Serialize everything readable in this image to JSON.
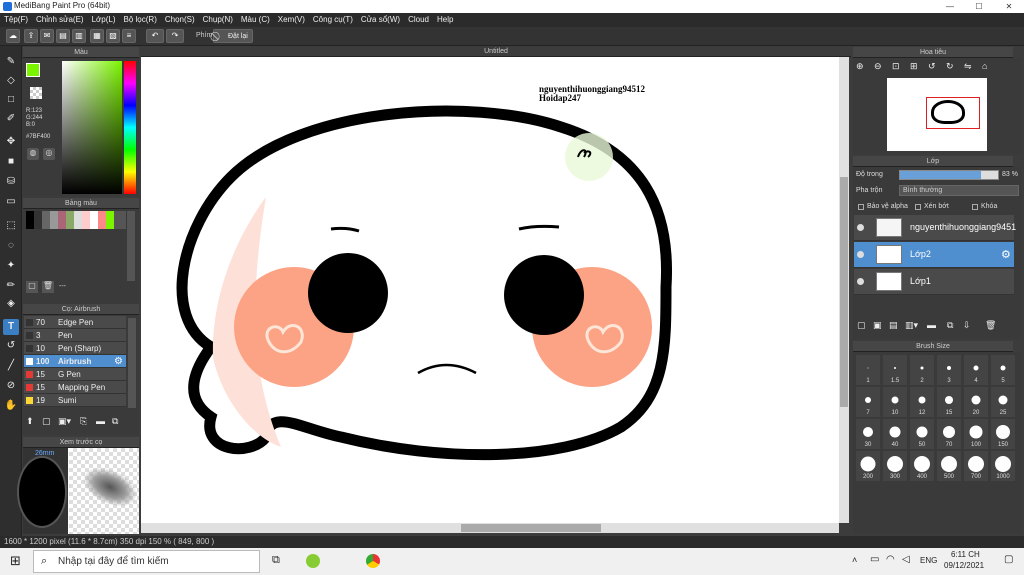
{
  "window": {
    "title": "MediBang Paint Pro (64bit)",
    "min": "—",
    "max": "☐",
    "close": "✕"
  },
  "menu": [
    "Tệp(F)",
    "Chỉnh sửa(E)",
    "Lớp(L)",
    "Bộ lọc(R)",
    "Chọn(S)",
    "Chụp(N)",
    "Màu (C)",
    "Xem(V)",
    "Công cụ(T)",
    "Cửa sổ(W)",
    "Cloud",
    "Help"
  ],
  "toolbar": {
    "undo": "↶",
    "redo": "↷",
    "key_label": "Phím",
    "reset_label": "Đặt lại"
  },
  "color_panel": {
    "title": "Màu",
    "r": "R:123",
    "g": "G:244",
    "b": "B:0",
    "hex": "#7BF400",
    "fg_color": "#7bf400"
  },
  "palette_panel": {
    "title": "Bảng màu",
    "dots": "---"
  },
  "brush_panel": {
    "title": "Cọ: Airbrush",
    "brushes": [
      {
        "size": "70",
        "name": "Edge Pen",
        "color": "#333333"
      },
      {
        "size": "3",
        "name": "Pen",
        "color": "#333333"
      },
      {
        "size": "10",
        "name": "Pen (Sharp)",
        "color": "#333333"
      },
      {
        "size": "100",
        "name": "Airbrush",
        "color": "#ffffff"
      },
      {
        "size": "15",
        "name": "G Pen",
        "color": "#e53935"
      },
      {
        "size": "15",
        "name": "Mapping Pen",
        "color": "#e53935"
      },
      {
        "size": "19",
        "name": "Sumi",
        "color": "#fdd835"
      }
    ]
  },
  "preview_panel": {
    "title": "Xem trước cọ",
    "size_text": "26mm"
  },
  "canvas": {
    "tab_title": "Untitled",
    "watermark_1": "nguyenthihuonggiang94512",
    "watermark_2": "Hoidap247"
  },
  "navigator_panel": {
    "title": "Hoa tiêu"
  },
  "layer_panel": {
    "title": "Lớp",
    "opacity_label": "Độ trong",
    "opacity_value": "83 %",
    "opacity": 0.83,
    "blend_label": "Pha trộn",
    "blend_value": "Bình thường",
    "protect_alpha": "Bảo vệ alpha",
    "clipping": "Xén bớt",
    "lock": "Khóa",
    "layers": [
      {
        "name": "nguyenthihuonggiang9451"
      },
      {
        "name": "Lớp2"
      },
      {
        "name": "Lớp1"
      }
    ]
  },
  "brush_size_panel": {
    "title": "Brush Size",
    "sizes": [
      "1",
      "1.5",
      "2",
      "3",
      "4",
      "5",
      "7",
      "10",
      "12",
      "15",
      "20",
      "25",
      "30",
      "40",
      "50",
      "70",
      "100",
      "150",
      "200",
      "300",
      "400",
      "500",
      "700",
      "1000"
    ]
  },
  "status": {
    "text": "1600 * 1200 pixel   (11.6 * 8.7cm)   350 dpi   150 %   ( 849, 800 )"
  },
  "taskbar": {
    "search_placeholder": "Nhập tại đây để tìm kiếm",
    "lang": "ENG",
    "time": "6:11 CH",
    "date": "09/12/2021"
  }
}
